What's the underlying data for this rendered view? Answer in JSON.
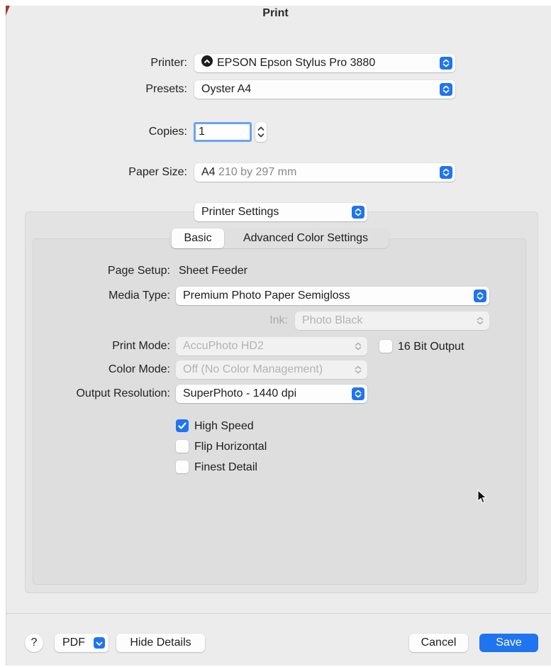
{
  "window": {
    "title": "Print"
  },
  "printer": {
    "label": "Printer:",
    "value": "EPSON Epson Stylus Pro 3880",
    "icon": "printer-status-icon"
  },
  "presets": {
    "label": "Presets:",
    "value": "Oyster A4"
  },
  "copies": {
    "label": "Copies:",
    "value": "1"
  },
  "paper_size": {
    "label": "Paper Size:",
    "name": "A4",
    "dimensions": "210 by 297 mm"
  },
  "section_popup": {
    "value": "Printer Settings"
  },
  "tabs": [
    {
      "label": "Basic",
      "active": true
    },
    {
      "label": "Advanced Color Settings",
      "active": false
    }
  ],
  "basic": {
    "page_setup": {
      "label": "Page Setup:",
      "value": "Sheet Feeder"
    },
    "media_type": {
      "label": "Media Type:",
      "value": "Premium Photo Paper Semigloss"
    },
    "ink": {
      "label": "Ink:",
      "value": "Photo Black"
    },
    "print_mode": {
      "label": "Print Mode:",
      "value": "AccuPhoto HD2"
    },
    "bit_output": {
      "label": "16 Bit Output",
      "checked": false
    },
    "color_mode": {
      "label": "Color Mode:",
      "value": "Off (No Color Management)"
    },
    "output_resolution": {
      "label": "Output Resolution:",
      "value": "SuperPhoto - 1440 dpi"
    },
    "options": [
      {
        "label": "High Speed",
        "checked": true
      },
      {
        "label": "Flip Horizontal",
        "checked": false
      },
      {
        "label": "Finest Detail",
        "checked": false
      }
    ]
  },
  "footer": {
    "help": "?",
    "pdf": "PDF",
    "hide_details": "Hide Details",
    "cancel": "Cancel",
    "save": "Save"
  },
  "colors": {
    "accent": "#1f74f0",
    "background": "#ececec",
    "panel": "#dedede"
  }
}
